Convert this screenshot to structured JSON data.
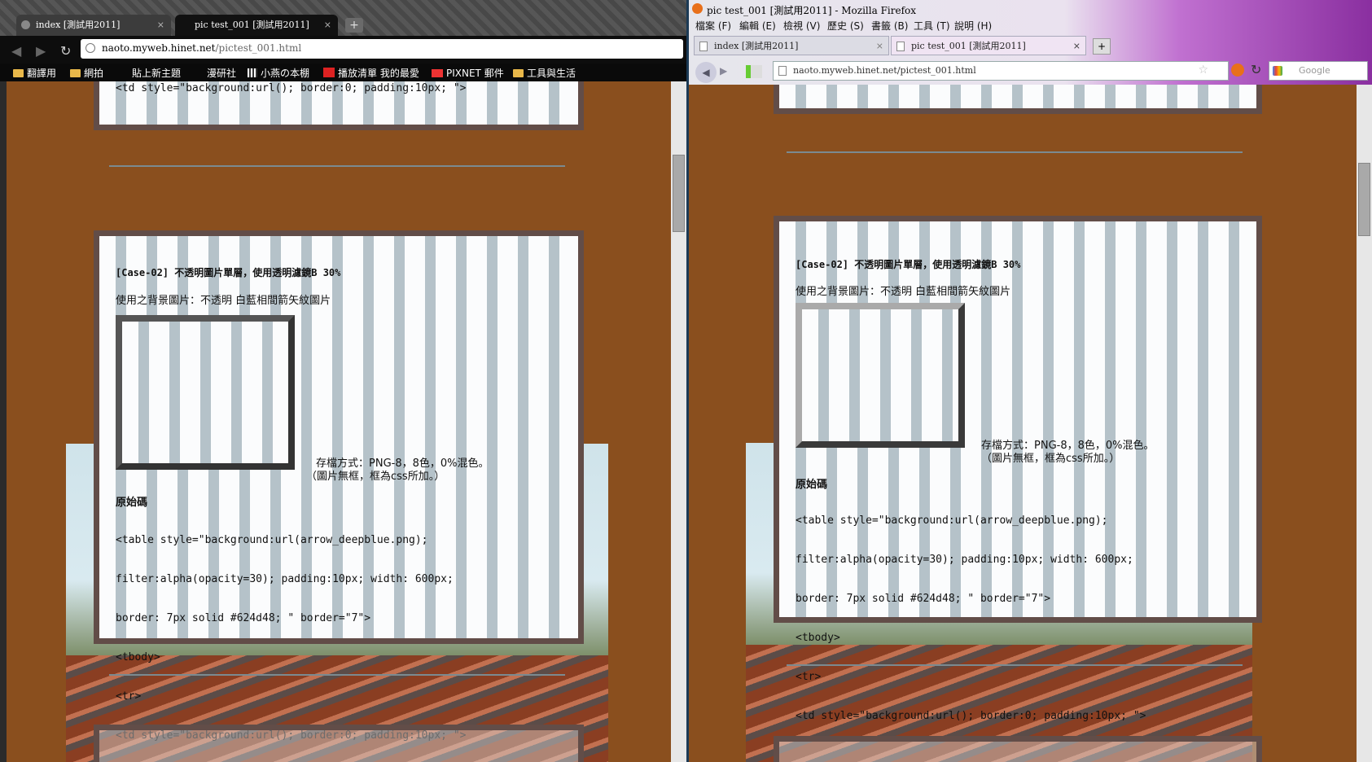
{
  "chrome": {
    "tabs": [
      {
        "label": "index [測試用2011]",
        "close": "×"
      },
      {
        "label": "pic test_001 [測試用2011]",
        "close": "×"
      }
    ],
    "new_tab": "+",
    "url_host": "naoto.myweb.hinet.net",
    "url_path": "/pictest_001.html",
    "bookmarks": [
      "翻譯用",
      "網拍",
      "貼上新主題",
      "漫研社",
      "小燕の本棚",
      "播放清單 我的最愛",
      "PIXNET 郵件",
      "工具與生活"
    ]
  },
  "firefox": {
    "window_title": "pic test_001 [測試用2011] - Mozilla Firefox",
    "menu": [
      "檔案 (F)",
      "編輯 (E)",
      "檢視 (V)",
      "歷史 (S)",
      "書籤 (B)",
      "工具 (T)",
      "說明 (H)"
    ],
    "tabs": [
      {
        "label": "index [測試用2011]",
        "close": "×"
      },
      {
        "label": "pic test_001 [測試用2011]",
        "close": "×"
      }
    ],
    "new_tab": "+",
    "url": "naoto.myweb.hinet.net/pictest_001.html",
    "search_placeholder": "Google"
  },
  "content": {
    "prev_code_tail": "<td style=\"background:url(); border:0; padding:10px; \">",
    "case_title": "[Case-02] 不透明圖片單層，使用透明濾鏡B 30%",
    "bg_desc": "使用之背景圖片：不透明  白藍相間箭矢紋圖片",
    "save_note_1": "存檔方式：PNG-8，8色，0%混色。",
    "save_note_2": "（圖片無框，框為css所加。）",
    "source_heading": "原始碼",
    "code_lines": [
      "<table style=\"background:url(arrow_deepblue.png);",
      "filter:alpha(opacity=30); padding:10px; width: 600px;",
      "border: 7px solid #624d48; \" border=\"7\">",
      "<tbody>",
      "<tr>",
      "<td style=\"background:url(); border:0; padding:10px; \">"
    ]
  }
}
